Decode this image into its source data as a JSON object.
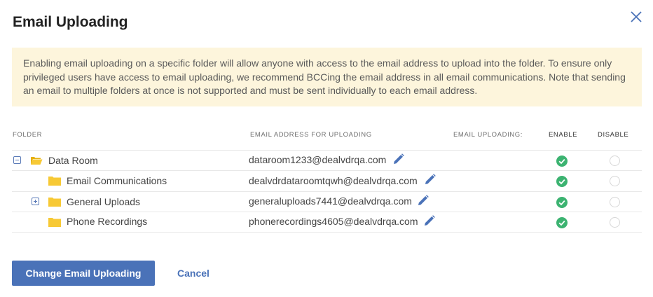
{
  "dialog": {
    "title": "Email Uploading",
    "notice": "Enabling email uploading on a specific folder will allow anyone with access to the email address to upload into the folder. To ensure only privileged users have access to email uploading, we recommend BCCing the email address in all email communications. Note that sending an email to multiple folders at once is not supported and must be sent individually to each email address."
  },
  "table": {
    "headers": {
      "folder": "FOLDER",
      "email": "EMAIL ADDRESS FOR UPLOADING",
      "uploading": "EMAIL UPLOADING:",
      "enable": "ENABLE",
      "disable": "DISABLE"
    },
    "rows": [
      {
        "name": "Data Room",
        "email": "dataroom1233@dealvdrqa.com",
        "expander": "collapse",
        "folder_icon": "folder-open-icon",
        "enabled": true
      },
      {
        "name": "Email Communications",
        "email": "dealvdrdataroomtqwh@dealvdrqa.com",
        "expander": "",
        "folder_icon": "folder-icon",
        "enabled": true
      },
      {
        "name": "General Uploads",
        "email": "generaluploads7441@dealvdrqa.com",
        "expander": "expand",
        "folder_icon": "folder-icon",
        "enabled": true
      },
      {
        "name": "Phone Recordings",
        "email": "phonerecordings4605@dealvdrqa.com",
        "expander": "",
        "folder_icon": "folder-icon",
        "enabled": true
      }
    ]
  },
  "footer": {
    "primary_label": "Change Email Uploading",
    "cancel_label": "Cancel"
  },
  "colors": {
    "accent": "#4a72b8",
    "notice_bg": "#fdf5dc",
    "folder": "#f5c518",
    "check": "#3cb371"
  }
}
